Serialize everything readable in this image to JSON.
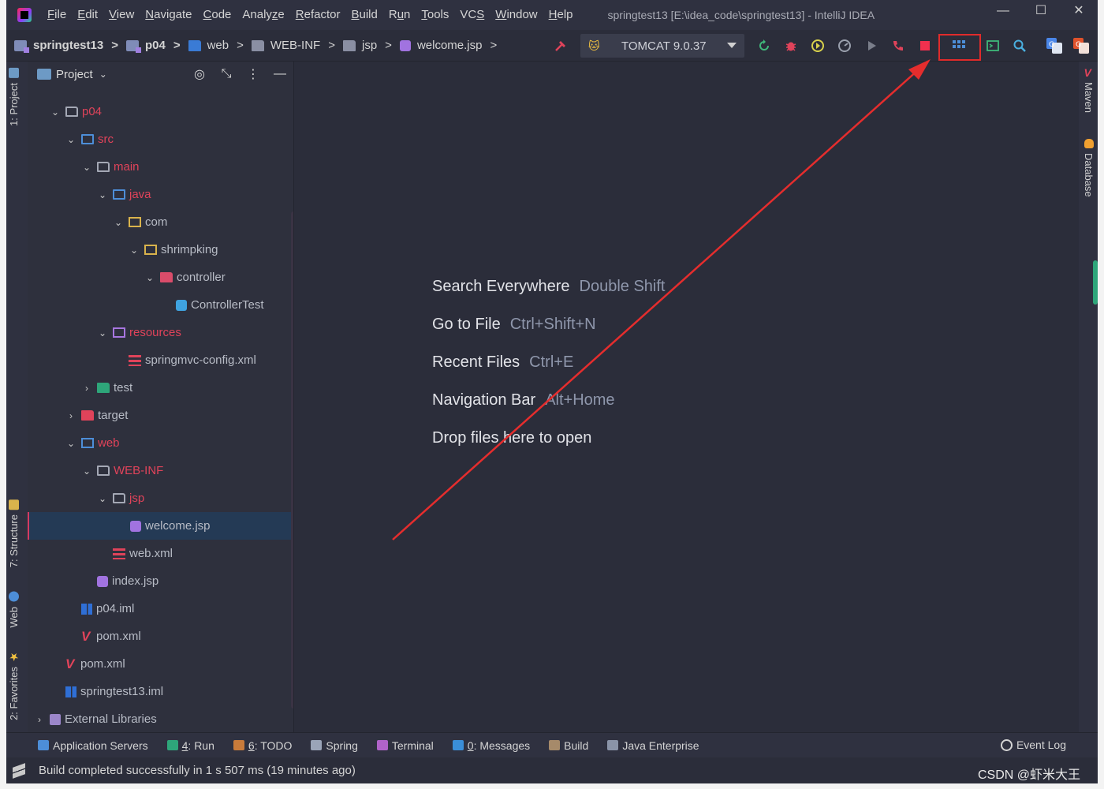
{
  "window": {
    "title": "springtest13 [E:\\idea_code\\springtest13] - IntelliJ IDEA",
    "controls": [
      "—",
      "☐",
      "✕"
    ]
  },
  "menu": {
    "items": [
      {
        "label": "File",
        "u": "F"
      },
      {
        "label": "Edit",
        "u": "E"
      },
      {
        "label": "View",
        "u": "V"
      },
      {
        "label": "Navigate",
        "u": "N"
      },
      {
        "label": "Code",
        "u": "C"
      },
      {
        "label": "Analyze",
        "u": "z"
      },
      {
        "label": "Refactor",
        "u": "R"
      },
      {
        "label": "Build",
        "u": "B"
      },
      {
        "label": "Run",
        "u": "u"
      },
      {
        "label": "Tools",
        "u": "T"
      },
      {
        "label": "VCS",
        "u": "S"
      },
      {
        "label": "Window",
        "u": "W"
      },
      {
        "label": "Help",
        "u": "H"
      }
    ]
  },
  "breadcrumb": {
    "items": [
      "springtest13",
      "p04",
      "web",
      "WEB-INF",
      "jsp",
      "welcome.jsp"
    ],
    "separator": ">"
  },
  "run_config": {
    "label": "TOMCAT 9.0.37"
  },
  "project_panel": {
    "title": "Project",
    "caret": "⌄",
    "header_icons": [
      "◎",
      "⤡",
      "⋮",
      "—"
    ],
    "tree": [
      {
        "label": "p04",
        "depth": 1,
        "arrow": "⌄",
        "icon": "folder",
        "style": "red"
      },
      {
        "label": "src",
        "depth": 2,
        "arrow": "⌄",
        "icon": "folder-blue",
        "style": "red"
      },
      {
        "label": "main",
        "depth": 3,
        "arrow": "⌄",
        "icon": "folder",
        "style": "red"
      },
      {
        "label": "java",
        "depth": 4,
        "arrow": "⌄",
        "icon": "folder-blue",
        "style": "red"
      },
      {
        "label": "com",
        "depth": 5,
        "arrow": "⌄",
        "icon": "folder-pkg",
        "style": ""
      },
      {
        "label": "shrimpking",
        "depth": 6,
        "arrow": "⌄",
        "icon": "folder-pkg",
        "style": ""
      },
      {
        "label": "controller",
        "depth": 7,
        "arrow": "⌄",
        "icon": "folder-ctrl",
        "style": ""
      },
      {
        "label": "ControllerTest",
        "depth": 8,
        "arrow": "",
        "icon": "class",
        "style": ""
      },
      {
        "label": "resources",
        "depth": 4,
        "arrow": "⌄",
        "icon": "folder-res",
        "style": "red"
      },
      {
        "label": "springmvc-config.xml",
        "depth": 5,
        "arrow": "",
        "icon": "xml",
        "style": ""
      },
      {
        "label": "test",
        "depth": 3,
        "arrow": "›",
        "icon": "folder-test",
        "style": ""
      },
      {
        "label": "target",
        "depth": 2,
        "arrow": "›",
        "icon": "folder-target",
        "style": ""
      },
      {
        "label": "web",
        "depth": 2,
        "arrow": "⌄",
        "icon": "folder-web",
        "style": "red"
      },
      {
        "label": "WEB-INF",
        "depth": 3,
        "arrow": "⌄",
        "icon": "folder",
        "style": "red"
      },
      {
        "label": "jsp",
        "depth": 4,
        "arrow": "⌄",
        "icon": "folder",
        "style": "red"
      },
      {
        "label": "welcome.jsp",
        "depth": 5,
        "arrow": "",
        "icon": "jsp",
        "style": "selected"
      },
      {
        "label": "web.xml",
        "depth": 4,
        "arrow": "",
        "icon": "xml",
        "style": ""
      },
      {
        "label": "index.jsp",
        "depth": 3,
        "arrow": "",
        "icon": "jsp",
        "style": ""
      },
      {
        "label": "p04.iml",
        "depth": 2,
        "arrow": "",
        "icon": "iml",
        "style": ""
      },
      {
        "label": "pom.xml",
        "depth": 2,
        "arrow": "",
        "icon": "maven",
        "style": ""
      },
      {
        "label": "pom.xml",
        "depth": 1,
        "arrow": "",
        "icon": "maven",
        "style": ""
      },
      {
        "label": "springtest13.iml",
        "depth": 1,
        "arrow": "",
        "icon": "iml",
        "style": ""
      },
      {
        "label": "External Libraries",
        "depth": 0,
        "arrow": "›",
        "icon": "lib",
        "style": ""
      }
    ]
  },
  "left_tabs": {
    "project": "1: Project",
    "structure": "7: Structure",
    "web": "Web",
    "favorites": "2: Favorites"
  },
  "right_tabs": {
    "maven": "Maven",
    "database": "Database"
  },
  "editor_hints": [
    {
      "action": "Search Everywhere",
      "shortcut": "Double Shift"
    },
    {
      "action": "Go to File",
      "shortcut": "Ctrl+Shift+N"
    },
    {
      "action": "Recent Files",
      "shortcut": "Ctrl+E"
    },
    {
      "action": "Navigation Bar",
      "shortcut": "Alt+Home"
    },
    {
      "action": "Drop files here to open",
      "shortcut": ""
    }
  ],
  "bottom_tabs": [
    {
      "label": "Application Servers",
      "num": "",
      "color": "#4d8ed8"
    },
    {
      "label": ": Run",
      "num": "4",
      "color": "#2ea67a"
    },
    {
      "label": ": TODO",
      "num": "6",
      "color": "#c97b3a"
    },
    {
      "label": "Spring",
      "num": "",
      "color": "#9aa4b8"
    },
    {
      "label": "Terminal",
      "num": "",
      "color": "#b063c9"
    },
    {
      "label": ": Messages",
      "num": "0",
      "color": "#3a8ed8"
    },
    {
      "label": "Build",
      "num": "",
      "color": "#a68a6a"
    },
    {
      "label": "Java Enterprise",
      "num": "",
      "color": "#8a94a8"
    }
  ],
  "event_log": "Event Log",
  "status": {
    "message": "Build completed successfully in 1 s 507 ms (19 minutes ago)",
    "watermark": "CSDN @虾米大王"
  },
  "colors": {
    "accent_red": "#e02b2b",
    "selection": "#243a55",
    "background": "#2b2d3a"
  }
}
